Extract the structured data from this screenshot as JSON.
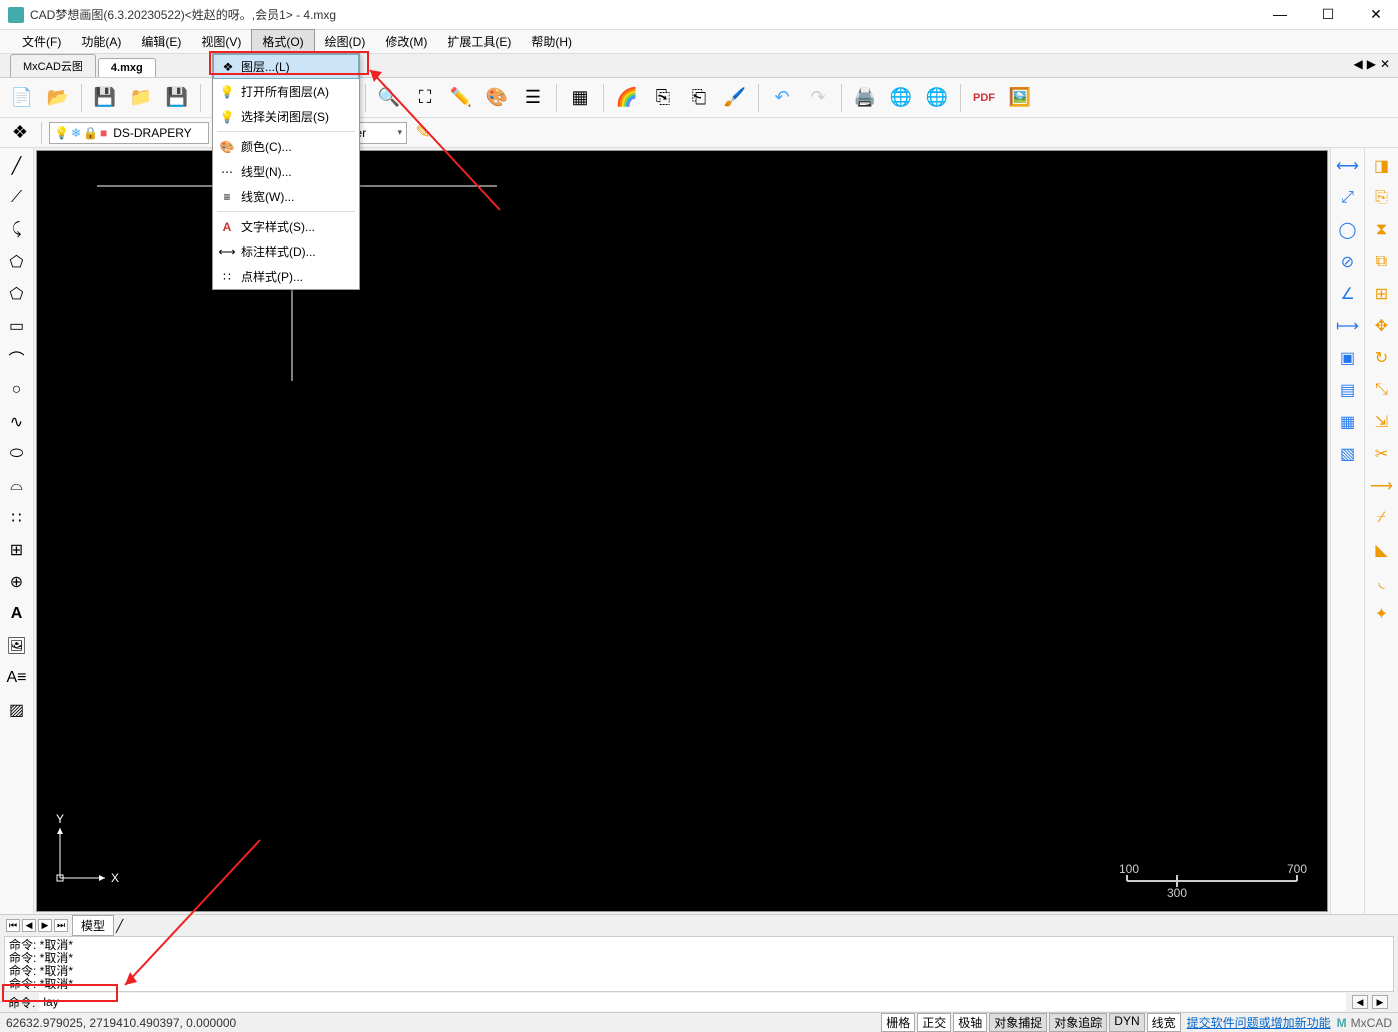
{
  "title": "CAD梦想画图(6.3.20230522)<姓赵的呀。,会员1> - 4.mxg",
  "menus": {
    "file": "文件(F)",
    "function": "功能(A)",
    "edit": "编辑(E)",
    "view": "视图(V)",
    "format": "格式(O)",
    "draw": "绘图(D)",
    "modify": "修改(M)",
    "extend": "扩展工具(E)",
    "help": "帮助(H)"
  },
  "tabs": {
    "tab1": "MxCAD云图",
    "tab2": "4.mxg"
  },
  "format_menu": {
    "layer": "图层...(L)",
    "open_all": "打开所有图层(A)",
    "close_sel": "选择关闭图层(S)",
    "color": "颜色(C)...",
    "linetype": "线型(N)...",
    "lineweight": "线宽(W)...",
    "textstyle": "文字样式(S)...",
    "dimstyle": "标注样式(D)...",
    "pointstyle": "点样式(P)..."
  },
  "layer": {
    "current": "DS-DRAPERY",
    "bylayer": "ByLayer"
  },
  "modeltab": "模型",
  "cmdlog": {
    "l1": "命令:  *取消*",
    "l2": "命令:  *取消*",
    "l3": "命令:  *取消*",
    "l4": "命令:  *取消*"
  },
  "cmdline": {
    "label": "命令:",
    "value": "lay"
  },
  "status": {
    "coords": "62632.979025,  2719410.490397,  0.000000",
    "grid": "栅格",
    "ortho": "正交",
    "polar": "极轴",
    "osnap": "对象捕捉",
    "otrack": "对象追踪",
    "dyn": "DYN",
    "lwt": "线宽",
    "feedback": "提交软件问题或增加新功能",
    "brand": "MxCAD"
  },
  "ruler": {
    "v100": "100",
    "v700": "700",
    "v300": "300"
  },
  "axis": {
    "x": "X",
    "y": "Y"
  }
}
